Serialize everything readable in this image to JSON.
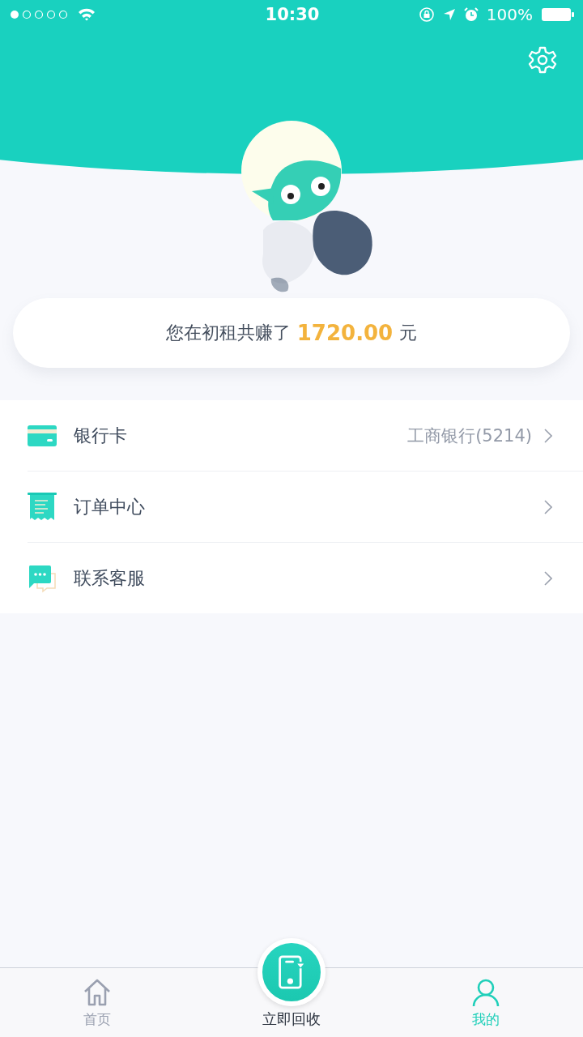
{
  "status_bar": {
    "time": "10:30",
    "battery": "100%"
  },
  "earnings": {
    "prefix": "您在初租共赚了",
    "amount": "1720.00",
    "suffix": "元"
  },
  "menu": [
    {
      "label": "银行卡",
      "value": "工商银行(5214)"
    },
    {
      "label": "订单中心"
    },
    {
      "label": "联系客服"
    }
  ],
  "tabs": [
    {
      "kind": "home",
      "label": "首页",
      "selected": false
    },
    {
      "kind": "center",
      "label": "立即回收",
      "selected": false
    },
    {
      "kind": "profile",
      "label": "我的",
      "selected": true
    }
  ]
}
